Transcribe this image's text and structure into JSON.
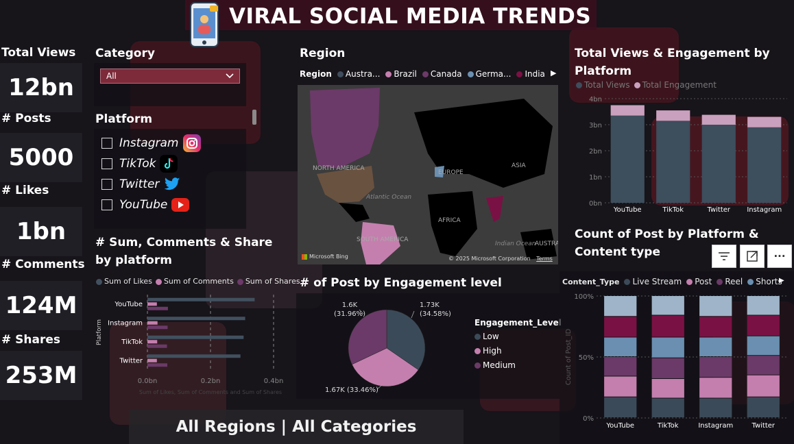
{
  "header": {
    "title": "VIRAL SOCIAL MEDIA TRENDS"
  },
  "kpis": [
    {
      "label": "Total Views",
      "value": "12bn"
    },
    {
      "label": "# Posts",
      "value": "5000"
    },
    {
      "label": "# Likes",
      "value": "1bn"
    },
    {
      "label": "# Comments",
      "value": "124M"
    },
    {
      "label": "# Shares",
      "value": "253M"
    }
  ],
  "filters": {
    "category_title": "Category",
    "category_value": "All",
    "platform_title": "Platform",
    "platforms": [
      "Instagram",
      "TikTok",
      "Twitter",
      "YouTube"
    ]
  },
  "map": {
    "title": "Region",
    "legend_title": "Region",
    "legend": [
      "Austra...",
      "Brazil",
      "Canada",
      "Germa...",
      "India"
    ],
    "legend_colors": [
      "#3f4d5e",
      "#c47fae",
      "#6b3a68",
      "#6a8fb0",
      "#7a1144"
    ],
    "labels": [
      "NORTH AMERICA",
      "EUROPE",
      "ASIA",
      "Atlantic Ocean",
      "AFRICA",
      "SOUTH AMERICA",
      "Indian Ocean",
      "AUSTRA"
    ],
    "attribution": "© 2025 Microsoft Corporation",
    "terms": "Terms",
    "bing": "Microsoft Bing"
  },
  "bottom_banner": {
    "text": "All Regions | All Categories"
  },
  "colors": {
    "views": "#3d4e5d",
    "engagement": "#c9a0bd",
    "likes": "#41505f",
    "comments": "#c47fae",
    "shares": "#6b3a68"
  },
  "chart_data": [
    {
      "id": "views_engagement",
      "type": "bar",
      "title": "Total Views & Engagement by Platform",
      "categories": [
        "YouTube",
        "TikTok",
        "Twitter",
        "Instagram"
      ],
      "series": [
        {
          "name": "Total Views",
          "values": [
            3.35,
            3.15,
            3.0,
            2.9
          ]
        },
        {
          "name": "Total Engagement",
          "values": [
            0.4,
            0.4,
            0.38,
            0.4
          ]
        }
      ],
      "ytick_labels": [
        "4bn",
        "3bn",
        "2bn",
        "1bn",
        "0bn"
      ],
      "yticks": [
        4,
        3,
        2,
        1,
        0
      ],
      "ylim": [
        0,
        4
      ],
      "stacked": true
    },
    {
      "id": "sum_comments_share",
      "type": "bar",
      "orientation": "horizontal",
      "title": "# Sum, Comments & Share by platform",
      "categories": [
        "YouTube",
        "Instagram",
        "TikTok",
        "Twitter"
      ],
      "series": [
        {
          "name": "Sum of Likes",
          "values": [
            0.34,
            0.31,
            0.305,
            0.295
          ]
        },
        {
          "name": "Sum of Comments",
          "values": [
            0.03,
            0.032,
            0.031,
            0.03
          ]
        },
        {
          "name": "Sum of Shares",
          "values": [
            0.065,
            0.064,
            0.062,
            0.063
          ]
        }
      ],
      "ylabel": "Platform",
      "xlabel": "Sum of Likes, Sum of Comments and Sum of Shares",
      "xtick_labels": [
        "0.0bn",
        "0.2bn",
        "0.4bn"
      ],
      "xticks": [
        0,
        0.2,
        0.4
      ],
      "xlim": [
        0,
        0.4
      ]
    },
    {
      "id": "posts_by_engagement",
      "type": "pie",
      "title": "# of Post by Engagement level",
      "legend_title": "Engagement_Level",
      "labels": [
        "Low",
        "High",
        "Medium"
      ],
      "values": [
        1730,
        1670,
        1600
      ],
      "data_labels": [
        [
          "1.73K",
          "(34.58%)"
        ],
        [
          "1.67K (33.46%)"
        ],
        [
          "1.6K",
          "(31.96%)"
        ]
      ],
      "colors": [
        "#3b4a58",
        "#c47fae",
        "#6b3a68"
      ]
    },
    {
      "id": "posts_by_content_type",
      "type": "bar",
      "title": "Count of Post by Platform & Content type",
      "stacked": true,
      "percent": true,
      "legend_title": "Content_Type",
      "categories": [
        "YouTube",
        "TikTok",
        "Instagram",
        "Twitter"
      ],
      "series": [
        {
          "name": "Live Stream",
          "values": [
            17,
            16,
            16,
            17
          ]
        },
        {
          "name": "Post",
          "values": [
            17,
            16,
            17,
            18
          ]
        },
        {
          "name": "Reel",
          "values": [
            16,
            17,
            17,
            16
          ]
        },
        {
          "name": "Shorts",
          "values": [
            16,
            17,
            16,
            16
          ]
        },
        {
          "name": "",
          "values": [
            17,
            18,
            17,
            17
          ]
        },
        {
          "name": "",
          "values": [
            17,
            16,
            17,
            16
          ]
        }
      ],
      "series_colors": [
        "#3b4a58",
        "#c47fae",
        "#6b3a68",
        "#6a8fb0",
        "#7a1144",
        "#9fb4c8"
      ],
      "ylabel": "Count of Post_ID",
      "ytick_labels": [
        "100%",
        "50%",
        "0%"
      ],
      "yticks": [
        100,
        50,
        0
      ]
    }
  ]
}
